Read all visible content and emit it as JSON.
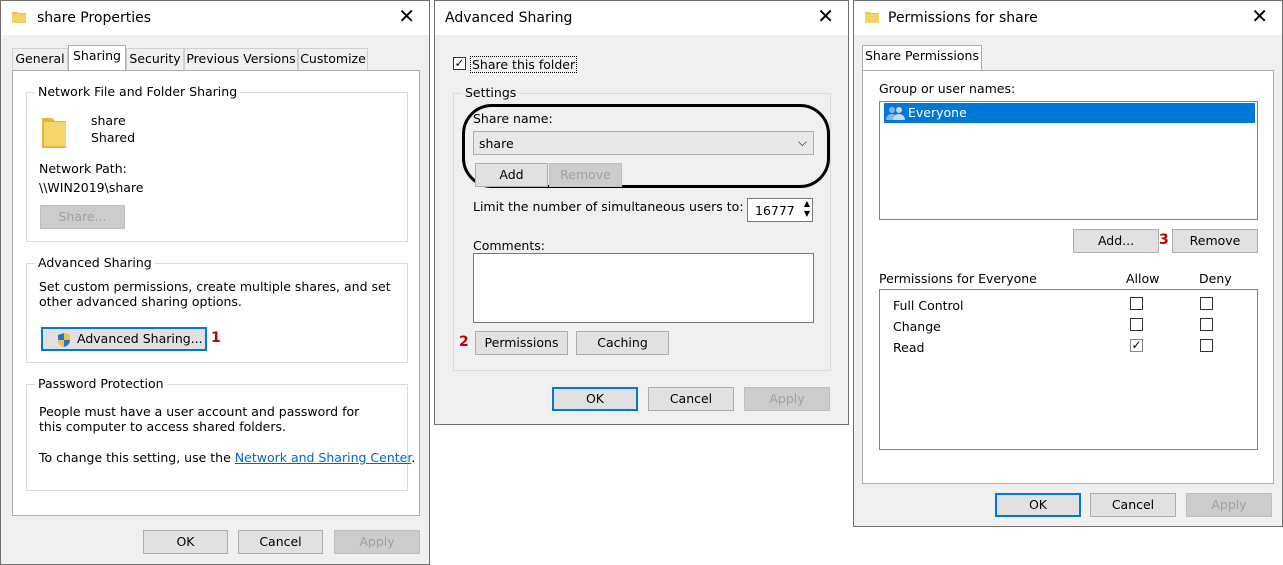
{
  "props": {
    "title": "share Properties",
    "tabs": [
      "General",
      "Sharing",
      "Security",
      "Previous Versions",
      "Customize"
    ],
    "nffs_group": "Network File and Folder Sharing",
    "share_name": "share",
    "share_state": "Shared",
    "network_path_label": "Network Path:",
    "network_path": "\\\\WIN2019\\share",
    "share_btn": "Share...",
    "adv_group": "Advanced Sharing",
    "adv_desc": "Set custom permissions, create multiple shares, and set other advanced sharing options.",
    "adv_btn": "Advanced Sharing...",
    "step1": "1",
    "pw_group": "Password Protection",
    "pw_desc": "People must have a user account and password for this computer to access shared folders.",
    "pw_change": "To change this setting, use the",
    "pw_link": "Network and Sharing Center",
    "pw_period": ".",
    "ok": "OK",
    "cancel": "Cancel",
    "apply": "Apply"
  },
  "adv": {
    "title": "Advanced Sharing",
    "share_folder": "Share this folder",
    "settings_group": "Settings",
    "share_name_label": "Share name:",
    "share_name_value": "share",
    "add": "Add",
    "remove": "Remove",
    "limit_label": "Limit the number of simultaneous users to:",
    "limit_value": "16777",
    "comments_label": "Comments:",
    "step2": "2",
    "permissions": "Permissions",
    "caching": "Caching",
    "ok": "OK",
    "cancel": "Cancel",
    "apply": "Apply"
  },
  "perm": {
    "title": "Permissions for share",
    "tab": "Share Permissions",
    "group_label": "Group or user names:",
    "user": "Everyone",
    "add": "Add...",
    "step3": "3",
    "remove": "Remove",
    "perm_label": "Permissions for Everyone",
    "allow": "Allow",
    "deny": "Deny",
    "rows": [
      {
        "name": "Full Control",
        "allow": false,
        "deny": false
      },
      {
        "name": "Change",
        "allow": false,
        "deny": false
      },
      {
        "name": "Read",
        "allow": true,
        "deny": false
      }
    ],
    "ok": "OK",
    "cancel": "Cancel",
    "apply": "Apply"
  },
  "colors": {
    "accent": "#0078d7",
    "step": "#c00000",
    "link": "#0066cc"
  }
}
